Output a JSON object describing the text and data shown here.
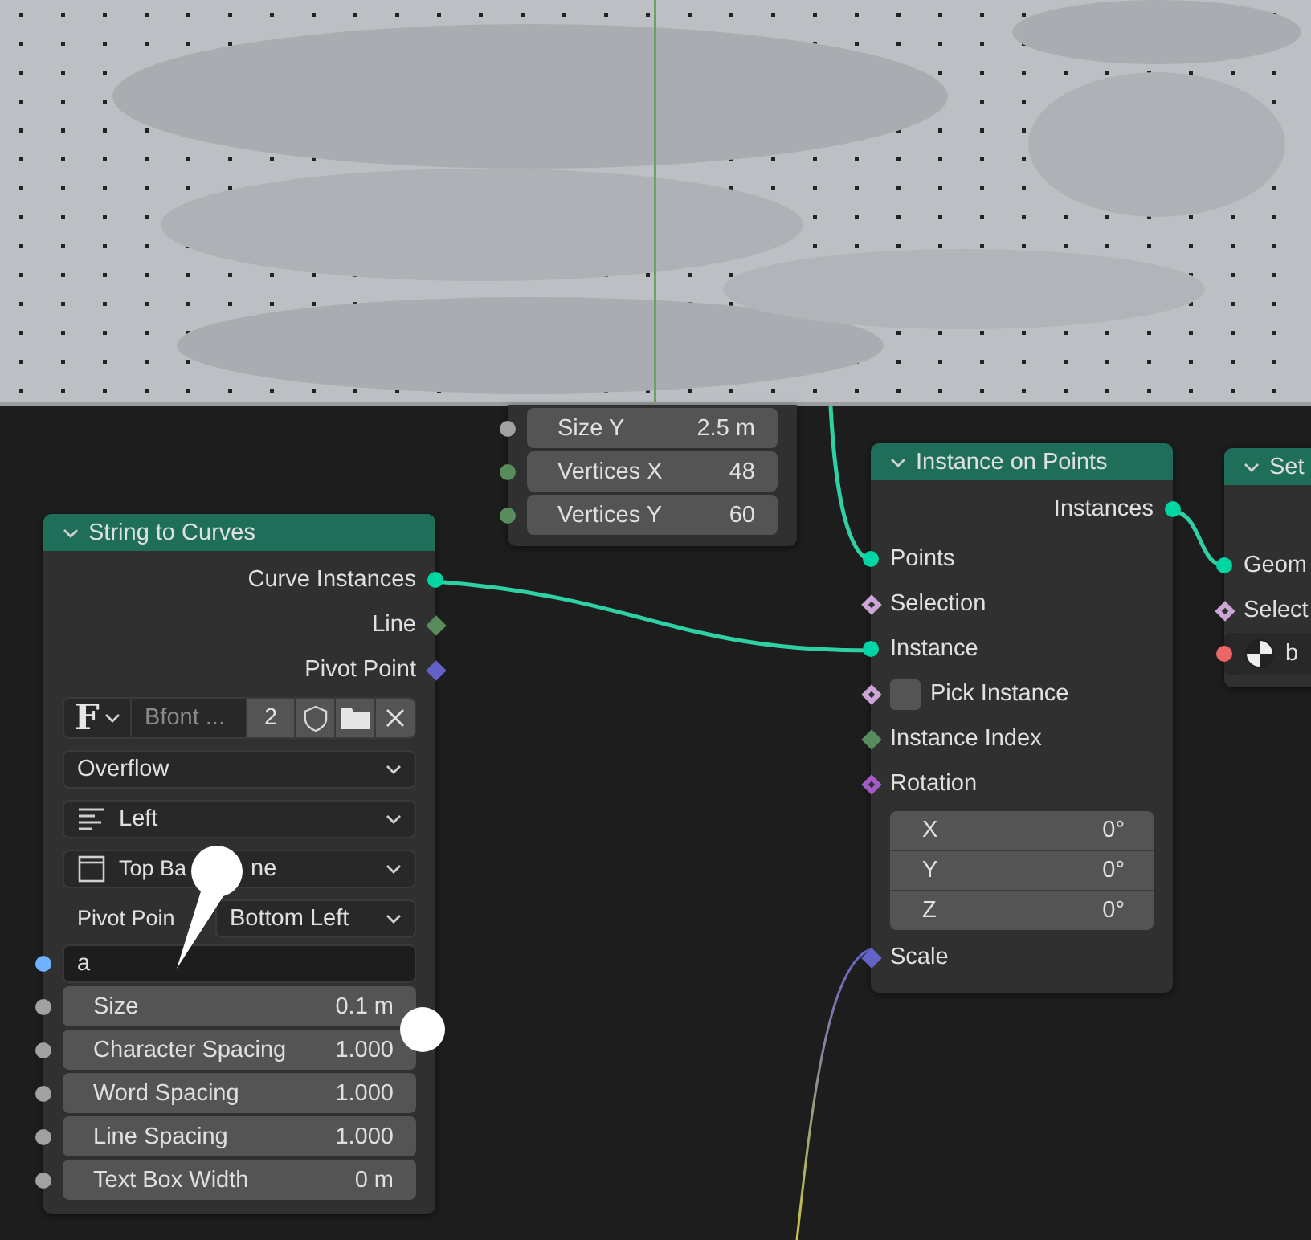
{
  "nodes": [
    {
      "rows": [
        {
          "kind": "value",
          "label": "Size Y",
          "value": "2.5 m",
          "socket": {
            "kind": "circle",
            "color": "#a1a1a1"
          }
        },
        {
          "kind": "value",
          "label": "Vertices X",
          "value": "48",
          "socket": {
            "kind": "circle",
            "color": "#598c5c"
          }
        },
        {
          "kind": "value",
          "label": "Vertices Y",
          "value": "60",
          "socket": {
            "kind": "circle",
            "color": "#598c5c"
          }
        }
      ]
    },
    {
      "title": "String to Curves",
      "rows": [
        {
          "kind": "output",
          "label": "Curve Instances",
          "socket": {
            "kind": "circle",
            "color": "#00d6a3"
          }
        },
        {
          "kind": "output",
          "label": "Line",
          "socket": {
            "kind": "diamond",
            "color": "#598c5c"
          }
        },
        {
          "kind": "output",
          "label": "Pivot Point",
          "socket": {
            "kind": "diamond",
            "color": "#6363c7"
          }
        },
        {
          "kind": "font",
          "icon_char": "F",
          "name": "Bfont ...",
          "users": "2"
        },
        {
          "kind": "dropdown",
          "value": "Overflow"
        },
        {
          "kind": "dropdown",
          "value": "Left"
        },
        {
          "kind": "dropdown",
          "value": "Top Ba",
          "value_tail": "ne"
        },
        {
          "kind": "labeled-dropdown",
          "label": "Pivot Poin",
          "value": "Bottom Left"
        },
        {
          "kind": "text",
          "value": "a",
          "socket": {
            "kind": "circle",
            "color": "#70b2ff"
          }
        },
        {
          "kind": "value",
          "label": "Size",
          "value": "0.1 m",
          "socket": {
            "kind": "circle",
            "color": "#a1a1a1"
          }
        },
        {
          "kind": "value",
          "label": "Character Spacing",
          "value": "1.000",
          "socket": {
            "kind": "circle",
            "color": "#a1a1a1"
          }
        },
        {
          "kind": "value",
          "label": "Word Spacing",
          "value": "1.000",
          "socket": {
            "kind": "circle",
            "color": "#a1a1a1"
          }
        },
        {
          "kind": "value",
          "label": "Line Spacing",
          "value": "1.000",
          "socket": {
            "kind": "circle",
            "color": "#a1a1a1"
          }
        },
        {
          "kind": "value",
          "label": "Text Box Width",
          "value": "0 m",
          "socket": {
            "kind": "circle",
            "color": "#a1a1a1"
          }
        }
      ]
    },
    {
      "title": "Instance on Points",
      "rows": [
        {
          "kind": "output",
          "label": "Instances",
          "socket": {
            "kind": "circle",
            "color": "#00d6a3"
          }
        },
        {
          "kind": "input",
          "label": "Points",
          "socket": {
            "kind": "circle",
            "color": "#00d6a3"
          }
        },
        {
          "kind": "input",
          "label": "Selection",
          "socket": {
            "kind": "diamond-dot",
            "color": "#cca6d6"
          }
        },
        {
          "kind": "input",
          "label": "Instance",
          "socket": {
            "kind": "circle",
            "color": "#00d6a3"
          }
        },
        {
          "kind": "checkbox",
          "label": "Pick Instance",
          "checked": false,
          "socket": {
            "kind": "diamond-dot",
            "color": "#cca6d6"
          }
        },
        {
          "kind": "input",
          "label": "Instance Index",
          "socket": {
            "kind": "diamond",
            "color": "#598c5c"
          }
        },
        {
          "kind": "input",
          "label": "Rotation",
          "socket": {
            "kind": "diamond-dot",
            "color": "#a35cc7"
          }
        },
        {
          "kind": "vector",
          "components": [
            {
              "label": "X",
              "value": "0°"
            },
            {
              "label": "Y",
              "value": "0°"
            },
            {
              "label": "Z",
              "value": "0°"
            }
          ]
        },
        {
          "kind": "input",
          "label": "Scale",
          "socket": {
            "kind": "diamond",
            "color": "#6363c7"
          }
        }
      ]
    },
    {
      "title": "Set",
      "rows": [
        {
          "kind": "input",
          "label": "Geom",
          "socket": {
            "kind": "circle",
            "color": "#00d6a3"
          }
        },
        {
          "kind": "input",
          "label": "Select",
          "socket": {
            "kind": "diamond-dot",
            "color": "#cca6d6"
          }
        },
        {
          "kind": "picker",
          "value": "b",
          "socket": {
            "kind": "circle",
            "color": "#ed6666"
          }
        }
      ]
    }
  ]
}
